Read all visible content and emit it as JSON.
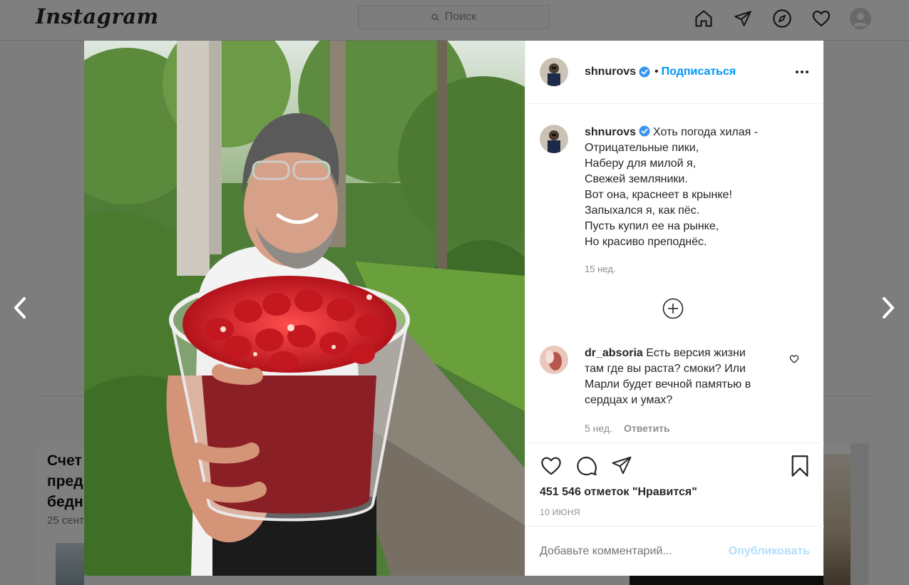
{
  "topbar": {
    "logo": "Instagram",
    "search_placeholder": "Поиск",
    "icons": [
      "home-icon",
      "direct-icon",
      "explore-icon",
      "activity-heart-icon",
      "profile-avatar"
    ]
  },
  "background": {
    "card_left_title": "Счет\nпред\nбедн",
    "card_left_date": "25 сент"
  },
  "post": {
    "author": "shnurovs",
    "verified": true,
    "separator": "•",
    "follow_label": "Подписаться",
    "caption": "Хоть погода хилая -\nОтрицательные пики,\nНаберу для милой я,\nСвежей земляники.\nВот она, краснеет в крынке!\nЗапыхался я, как пёс.\nПусть купил ее на рынке,\nНо красиво преподнёс.",
    "caption_time": "15 нед.",
    "comments": [
      {
        "author": "dr_absoria",
        "text": "Есть версия жизни\nтам где вы раста? смоки? Или\nМарли будет вечной памятью в\nсердцах и умах?",
        "time": "5 нед.",
        "reply_label": "Ответить"
      }
    ],
    "likes_text": "451 546 отметок \"Нравится\"",
    "date": "10 ИЮНЯ",
    "comment_placeholder": "Добавьте комментарий...",
    "publish_label": "Опубликовать"
  },
  "colors": {
    "accent": "#0095f6",
    "publish_disabled": "#b2dffc",
    "verified": "#3897f0",
    "overlay": "rgba(0,0,0,0.5)"
  }
}
